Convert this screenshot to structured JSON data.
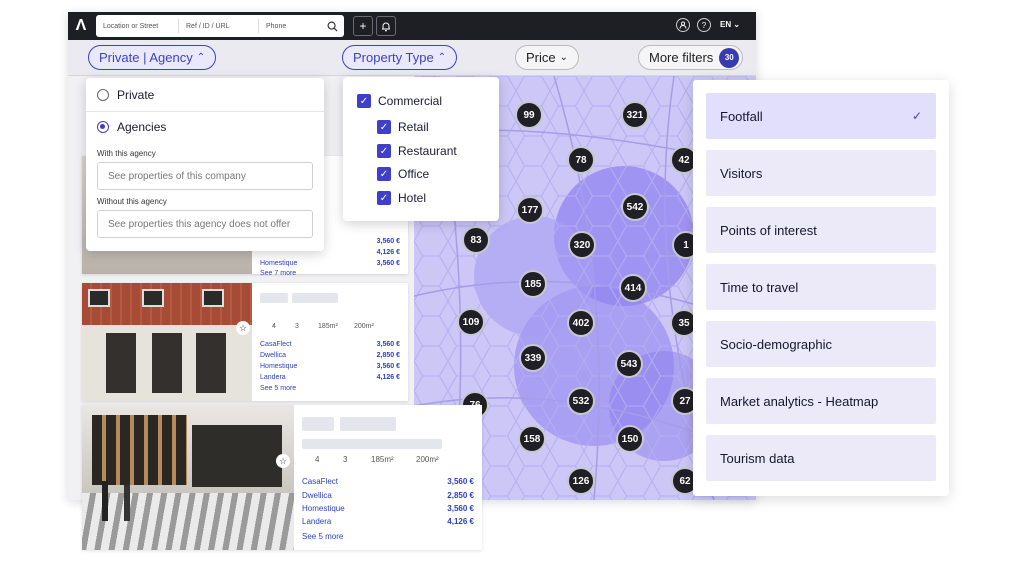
{
  "topbar": {
    "search": [
      "Location or Street",
      "Ref / ID / URL",
      "Phone"
    ],
    "lang": "EN"
  },
  "filters": {
    "private_agency": "Private | Agency",
    "property_type": "Property Type",
    "price": "Price",
    "more_filters": "More filters",
    "more_count": "30"
  },
  "seller_dropdown": {
    "private": "Private",
    "agencies": "Agencies",
    "with_label": "With this agency",
    "with_placeholder": "See properties of this company",
    "without_label": "Without this agency",
    "without_placeholder": "See properties this agency does not offer"
  },
  "type_dropdown": {
    "parent": "Commercial",
    "children": [
      "Retail",
      "Restaurant",
      "Office",
      "Hotel"
    ]
  },
  "cards": [
    {
      "prices": [
        [
          "",
          "3,560 €"
        ],
        [
          "",
          "4,126 €"
        ],
        [
          "Homestique",
          "3,560 €"
        ]
      ],
      "more": "See 7 more"
    },
    {
      "specs": [
        "4",
        "3",
        "185m²",
        "200m²"
      ],
      "prices": [
        [
          "CasaFlect",
          "3,560 €"
        ],
        [
          "Dwellica",
          "2,850 €"
        ],
        [
          "Homestique",
          "3,560 €"
        ],
        [
          "Landera",
          "4,126 €"
        ]
      ],
      "more": "See 5 more"
    },
    {
      "specs": [
        "4",
        "3",
        "185m²",
        "200m²"
      ],
      "prices": [
        [
          "CasaFlect",
          "3,560 €"
        ],
        [
          "Dwellica",
          "2,850 €"
        ],
        [
          "Homestique",
          "3,560 €"
        ],
        [
          "Landera",
          "4,126 €"
        ]
      ],
      "more": "See 5 more"
    }
  ],
  "clusters": [
    "99",
    "321",
    "78",
    "42",
    "177",
    "542",
    "83",
    "320",
    "1",
    "185",
    "414",
    "109",
    "402",
    "35",
    "339",
    "543",
    "76",
    "532",
    "27",
    "158",
    "150",
    "126",
    "62"
  ],
  "layers": [
    "Footfall",
    "Visitors",
    "Points of interest",
    "Time to travel",
    "Socio-demographic",
    "Market analytics - Heatmap",
    "Tourism data"
  ]
}
